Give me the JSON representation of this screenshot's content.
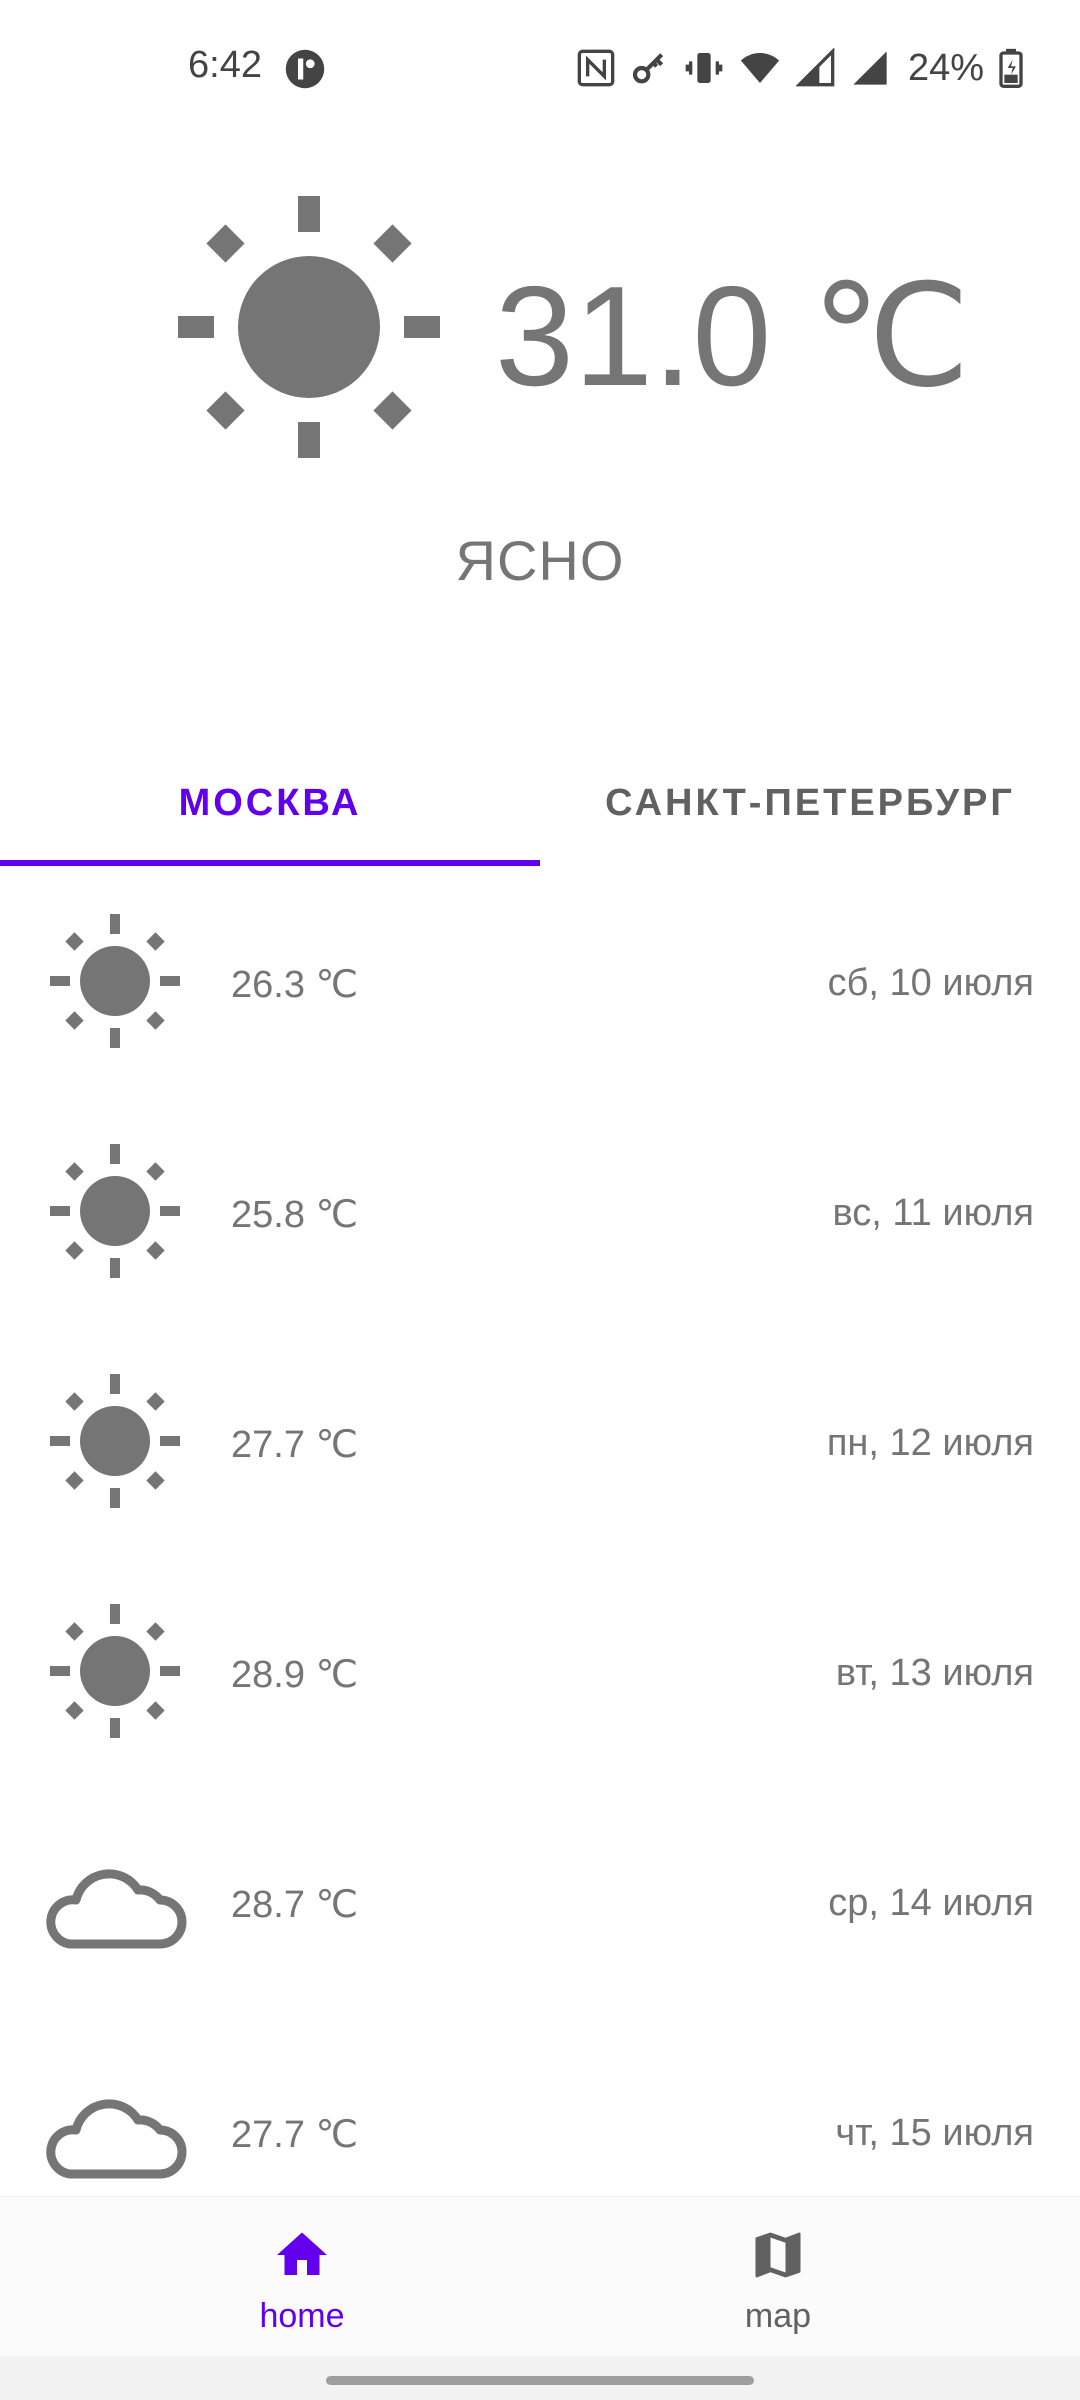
{
  "status_bar": {
    "time": "6:42",
    "battery_percent": "24%",
    "icons": [
      "app-notification-icon",
      "nfc-icon",
      "vpn-key-icon",
      "vibrate-icon",
      "wifi-icon",
      "signal-icon",
      "signal-icon",
      "battery-charging-icon"
    ]
  },
  "current": {
    "icon": "sun-icon",
    "temperature": "31.0 ℃",
    "condition": "ЯСНО"
  },
  "tabs": [
    {
      "label": "МОСКВА",
      "active": true
    },
    {
      "label": "САНКТ-ПЕТЕРБУРГ",
      "active": false
    }
  ],
  "forecast": [
    {
      "icon": "sun-icon",
      "temperature": "26.3 ℃",
      "date": "сб, 10 июля"
    },
    {
      "icon": "sun-icon",
      "temperature": "25.8 ℃",
      "date": "вс, 11 июля"
    },
    {
      "icon": "sun-icon",
      "temperature": "27.7 ℃",
      "date": "пн, 12 июля"
    },
    {
      "icon": "sun-icon",
      "temperature": "28.9 ℃",
      "date": "вт, 13 июля"
    },
    {
      "icon": "cloud-icon",
      "temperature": "28.7 ℃",
      "date": "ср, 14 июля"
    },
    {
      "icon": "cloud-icon",
      "temperature": "27.7 ℃",
      "date": "чт, 15 июля"
    }
  ],
  "bottom_nav": {
    "home_label": "home",
    "map_label": "map"
  },
  "colors": {
    "accent": "#6200EE",
    "icon_gray": "#757575",
    "text_gray": "#757575"
  }
}
